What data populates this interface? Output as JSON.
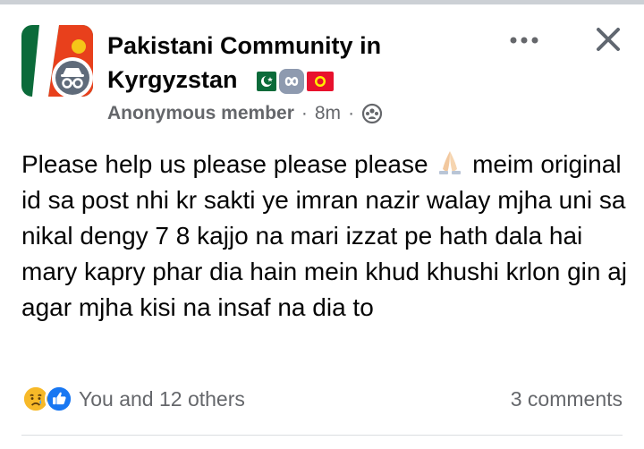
{
  "colors": {
    "text_primary": "#050505",
    "text_secondary": "#65676b",
    "like_blue": "#1877f2",
    "sad_yellow": "#f7b928"
  },
  "header": {
    "group_name": "Pakistani Community in Kyrgyzstan",
    "flags": [
      "pakistan-flag",
      "infinity-emoji",
      "kyrgyzstan-flag"
    ],
    "author": "Anonymous member",
    "separator": "·",
    "time": "8m",
    "audience_icon": "group-members-icon",
    "more_icon": "more-horizontal-icon",
    "close_icon": "close-icon"
  },
  "post": {
    "text_before_emoji": "Please help us please please please ",
    "emoji": "folded-hands-emoji",
    "text_after_emoji": " meim original id sa post nhi kr sakti ye imran nazir walay mjha uni sa nikal dengy 7 8 kajjo na mari izzat pe hath dala hai mary kapry phar dia hain mein khud khushi krlon gin aj agar mjha kisi na insaf na dia to"
  },
  "footer": {
    "reaction_icons": [
      "sad-reaction-icon",
      "like-reaction-icon"
    ],
    "reaction_summary": "You and 12 others",
    "comments": "3 comments"
  }
}
